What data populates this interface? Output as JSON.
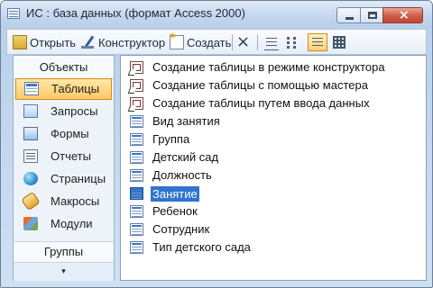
{
  "window": {
    "title": "ИС : база данных (формат Access 2000)"
  },
  "toolbar": {
    "open_label": "Открыть",
    "design_label": "Конструктор",
    "new_label": "Создать",
    "icons": [
      "open-icon",
      "design-icon",
      "new-icon",
      "delete-icon",
      "small-icons-icon",
      "list-icon",
      "details-icon",
      "table-view-icon"
    ]
  },
  "sidebar": {
    "header": "Объекты",
    "items": [
      {
        "label": "Таблицы",
        "icon": "table-icon",
        "selected": true
      },
      {
        "label": "Запросы",
        "icon": "query-icon"
      },
      {
        "label": "Формы",
        "icon": "form-icon"
      },
      {
        "label": "Отчеты",
        "icon": "report-icon"
      },
      {
        "label": "Страницы",
        "icon": "page-icon"
      },
      {
        "label": "Макросы",
        "icon": "macro-icon"
      },
      {
        "label": "Модули",
        "icon": "module-icon"
      }
    ],
    "groups": "Группы"
  },
  "objects": {
    "items": [
      {
        "label": "Создание таблицы в режиме конструктора",
        "icon": "shortcut-icon"
      },
      {
        "label": "Создание таблицы с помощью мастера",
        "icon": "shortcut-icon"
      },
      {
        "label": "Создание таблицы путем ввода данных",
        "icon": "shortcut-icon"
      },
      {
        "label": "Вид занятия",
        "icon": "table-icon"
      },
      {
        "label": "Группа",
        "icon": "table-icon"
      },
      {
        "label": "Детский сад",
        "icon": "table-icon"
      },
      {
        "label": "Должность",
        "icon": "table-icon"
      },
      {
        "label": "Занятие",
        "icon": "table-icon",
        "selected": true
      },
      {
        "label": "Ребенок",
        "icon": "table-icon"
      },
      {
        "label": "Сотрудник",
        "icon": "table-icon"
      },
      {
        "label": "Тип детского сада",
        "icon": "table-icon"
      }
    ]
  },
  "colors": {
    "selection": "#3073d2",
    "active_nav": "#ffc96a",
    "title_bar": "#c4d8ef"
  }
}
